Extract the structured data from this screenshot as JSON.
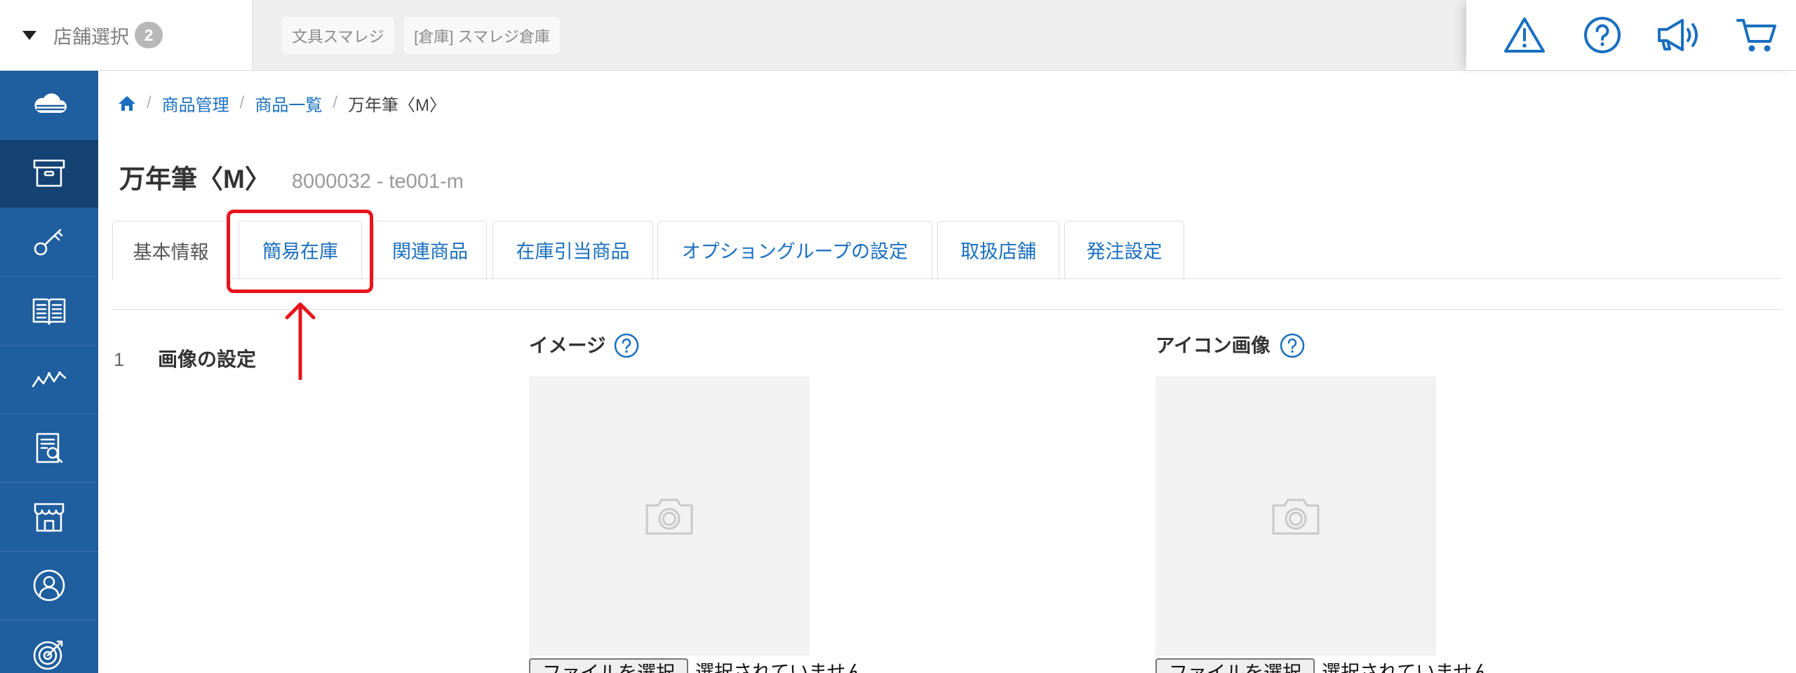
{
  "header": {
    "store_selector": {
      "label": "店舗選択",
      "count": "2"
    },
    "store_tags": [
      "文具スマレジ",
      "[倉庫] スマレジ倉庫"
    ],
    "utility_icons": [
      "warning-icon",
      "help-icon",
      "megaphone-icon",
      "cart-icon"
    ]
  },
  "sidebar": {
    "items": [
      "cloud-icon",
      "archive-box-icon",
      "key-icon",
      "book-icon",
      "line-chart-icon",
      "report-search-icon",
      "store-icon",
      "user-circle-icon",
      "target-icon"
    ],
    "active_index": 1
  },
  "breadcrumb": {
    "home_icon": "home-icon",
    "separator": "/",
    "items": [
      "商品管理",
      "商品一覧"
    ],
    "current": "万年筆〈M〉"
  },
  "product": {
    "name": "万年筆〈M〉",
    "code": "8000032 - te001-m"
  },
  "tabs": [
    {
      "label": "基本情報",
      "active": true
    },
    {
      "label": "簡易在庫",
      "active": false
    },
    {
      "label": "関連商品",
      "active": false
    },
    {
      "label": "在庫引当商品",
      "active": false
    },
    {
      "label": "オプショングループの設定",
      "active": false
    },
    {
      "label": "取扱店舗",
      "active": false
    },
    {
      "label": "発注設定",
      "active": false
    }
  ],
  "image_settings": {
    "section_number": "1",
    "section_title": "画像の設定",
    "image": {
      "label": "イメージ",
      "file_button": "ファイルを選択",
      "file_status": "選択されていません"
    },
    "icon_image": {
      "label": "アイコン画像",
      "file_button": "ファイルを選択",
      "file_status": "選択されていません"
    }
  },
  "annotation": {
    "highlight_tab_index": 1
  },
  "colors": {
    "primary": "#1a6fc0",
    "sidebar": "#1f5e9f",
    "sidebar_active": "#134273",
    "annotation": "#e8141c"
  }
}
